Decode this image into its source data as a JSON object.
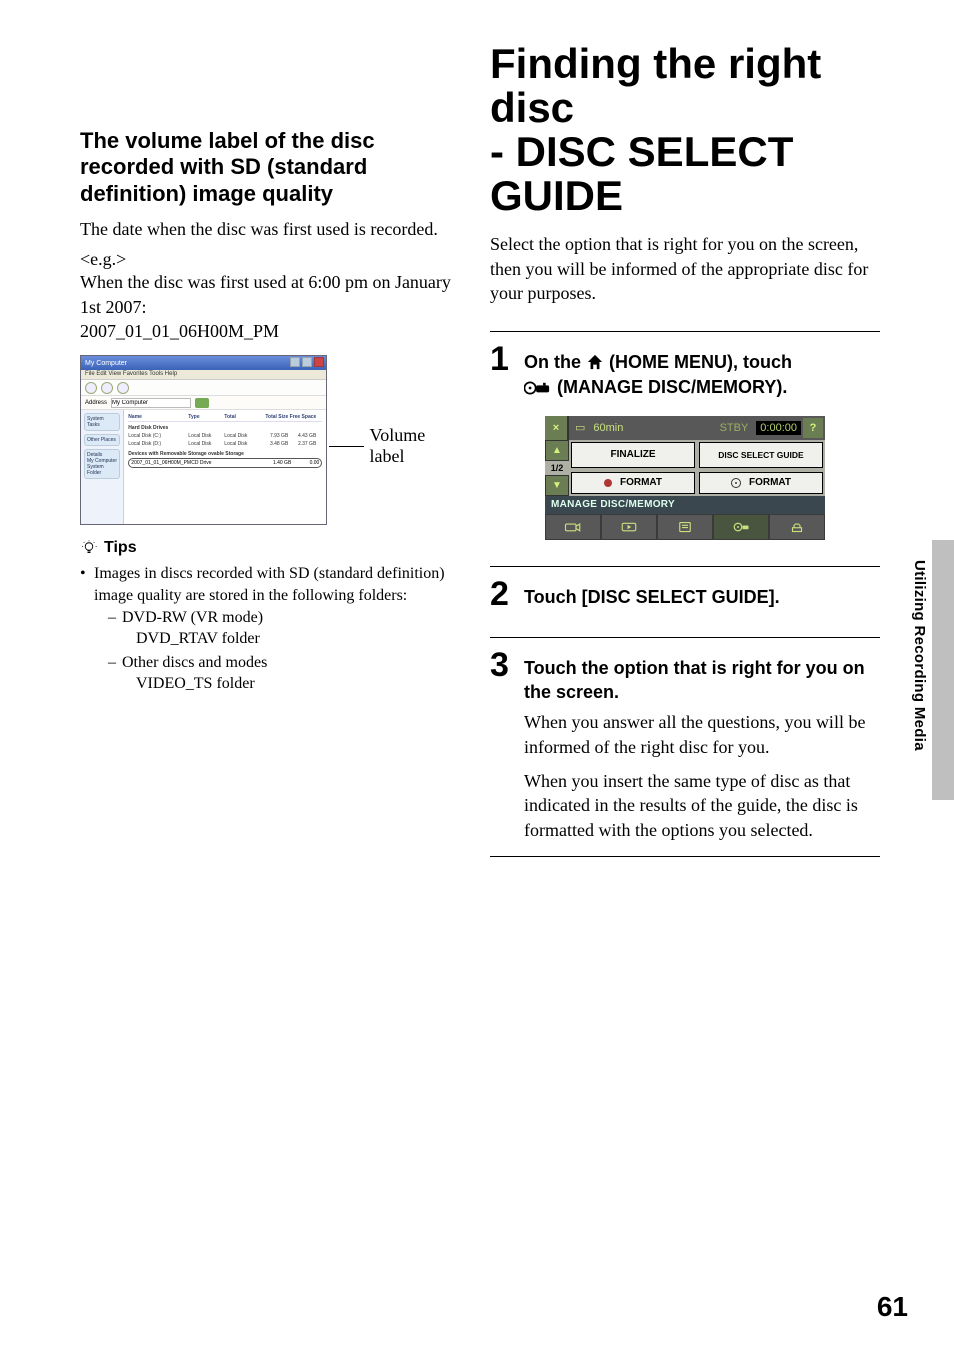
{
  "left": {
    "heading": "The volume label of the disc recorded with SD (standard definition) image quality",
    "p1": "The date when the disc was first used is recorded.",
    "eg": "<e.g.>",
    "p2": "When the disc was first used at 6:00 pm on January 1st 2007:",
    "p3": "2007_01_01_06H00M_PM",
    "callout": "Volume label",
    "tips_label": "Tips",
    "tip1": "Images in discs recorded with SD (standard definition) image quality are stored in the following folders:",
    "tip1a": "DVD-RW (VR mode)",
    "tip1a2": "DVD_RTAV folder",
    "tip1b": "Other discs and modes",
    "tip1b2": "VIDEO_TS folder"
  },
  "shot": {
    "title": "My Computer",
    "menu": "File   Edit   View   Favorites   Tools   Help",
    "addr_label": "Address",
    "addr_value": "My Computer",
    "side_g1": "System Tasks",
    "side_g2": "Other Places",
    "side_g3": "Details",
    "side_g3b": "My Computer\nSystem Folder",
    "hdr": {
      "c1": "Name",
      "c2": "Type",
      "c3": "Total",
      "c4": "Total Size",
      "c5": "Free Space"
    },
    "sect1": "Hard Disk Drives",
    "r1": {
      "c1": "Local Disk (C:)",
      "c2": "Local Disk",
      "c3": "Local Disk",
      "c4": "7.93 GB",
      "c5": "4.43 GB"
    },
    "r2": {
      "c1": "Local Disk (D:)",
      "c2": "Local Disk",
      "c3": "Local Disk",
      "c4": "3.48 GB",
      "c5": "2.37 GB"
    },
    "sect2": "Devices with Removable Storage    ovable Storage",
    "hl": {
      "c1": "2007_01_01_06H00M_PM",
      "c2": "CD Drive",
      "c3": "",
      "c4": "1.40 GB",
      "c5": "0.00"
    }
  },
  "right": {
    "title1": "Finding the right disc",
    "title2": "- DISC SELECT GUIDE",
    "intro": "Select the option that is right for you on the screen, then you will be informed of the appropriate disc for your purposes.",
    "step1a": "On the ",
    "step1b": " (HOME MENU), touch",
    "step1c": " (MANAGE DISC/MEMORY).",
    "step2": "Touch [DISC SELECT GUIDE].",
    "step3": "Touch the option that is right for you on the screen.",
    "step3_p1": "When you answer all the questions, you will be informed of the right disc for you.",
    "step3_p2": "When you insert the same type of disc as that indicated in the results of the guide, the disc is formatted with the options you selected."
  },
  "lcd": {
    "batt": "60min",
    "stby": "STBY",
    "time": "0:00:00",
    "page": "1/2",
    "finalize": "FINALIZE",
    "dsg": "DISC SELECT GUIDE",
    "fmt1": "FORMAT",
    "fmt2": "FORMAT",
    "section": "MANAGE DISC/MEMORY"
  },
  "side_label": "Utilizing Recording Media",
  "page_number": "61"
}
